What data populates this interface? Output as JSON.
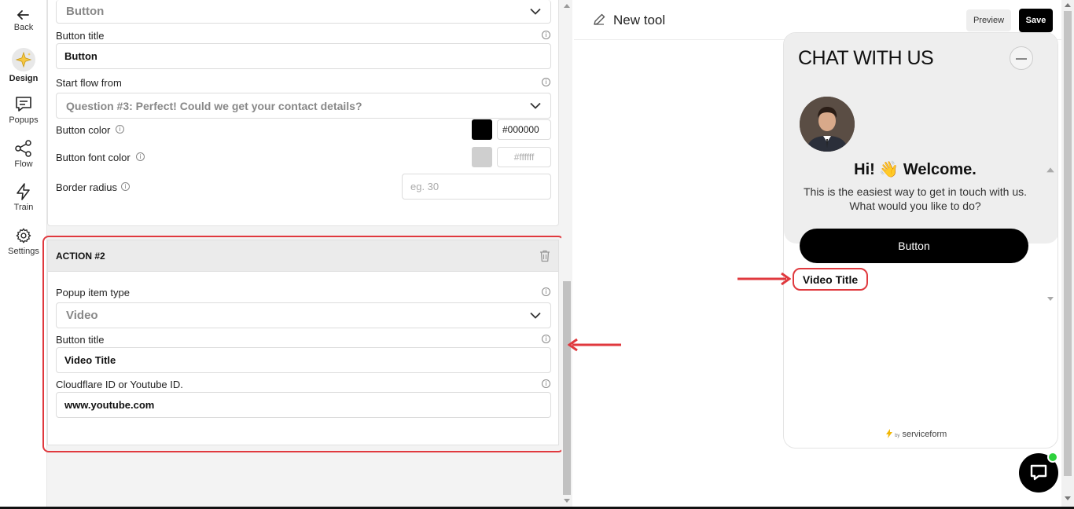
{
  "nav": {
    "back": "Back",
    "design": "Design",
    "popups": "Popups",
    "flow": "Flow",
    "train": "Train",
    "settings": "Settings"
  },
  "action1": {
    "type_value": "Button",
    "button_title_label": "Button title",
    "button_title_value": "Button",
    "start_flow_label": "Start flow from",
    "start_flow_value": "Question #3: Perfect! Could we get your contact details?",
    "button_color_label": "Button color",
    "button_color_value": "#000000",
    "button_font_color_label": "Button font color",
    "button_font_color_placeholder": "#ffffff",
    "border_radius_label": "Border radius",
    "border_radius_placeholder": "eg. 30"
  },
  "action2": {
    "heading": "ACTION #2",
    "popup_type_label": "Popup item type",
    "popup_type_value": "Video",
    "button_title_label": "Button title",
    "button_title_value": "Video Title",
    "cloudflare_label": "Cloudflare ID or Youtube ID.",
    "cloudflare_value": "www.youtube.com"
  },
  "topbar": {
    "tool_name": "New tool",
    "preview": "Preview",
    "save": "Save"
  },
  "widget": {
    "title": "CHAT WITH US",
    "welcome": "Hi! 👋 Welcome.",
    "subtext": "This is the easiest way to get in touch with us. What would you like to do?",
    "button": "Button",
    "video_title": "Video Title",
    "powered_by": "by",
    "brand": "serviceform"
  },
  "colors": {
    "accent_red": "#e0393e",
    "button_black": "#000000",
    "online_green": "#2dd13c"
  }
}
